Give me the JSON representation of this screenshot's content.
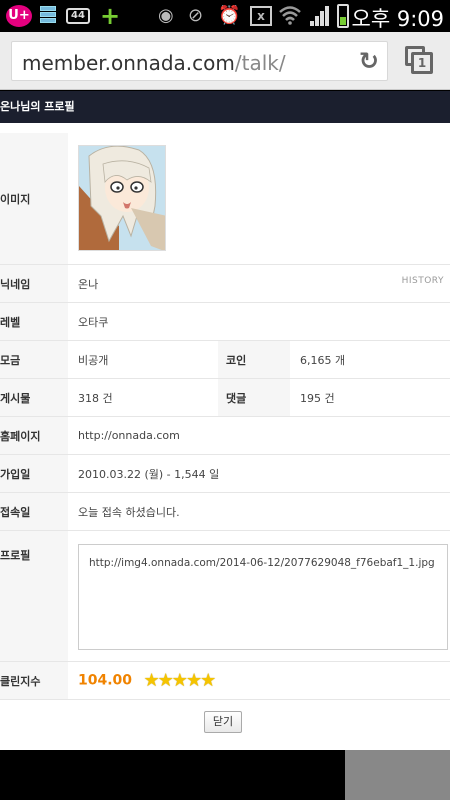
{
  "status_bar": {
    "carrier_badge": "U+",
    "notification_count": "44",
    "time": "오후 9:09"
  },
  "browser": {
    "url_host": "member.onnada.com",
    "url_path": "/talk/",
    "tab_count": "1"
  },
  "page": {
    "header_title": "온나님의 프로필",
    "rows": {
      "image_label": "이미지",
      "nickname_label": "닉네임",
      "nickname_value": "온나",
      "history_link": "HISTORY",
      "level_label": "레벨",
      "level_value": "오타쿠",
      "gender_label": "모금",
      "gender_value": "비공개",
      "coin_label": "코인",
      "coin_value": "6,165 개",
      "posts_label": "게시물",
      "posts_value": "318 건",
      "comments_label": "댓글",
      "comments_value": "195 건",
      "homepage_label": "홈페이지",
      "homepage_value": "http://onnada.com",
      "joined_label": "가입일",
      "joined_value": "2010.03.22 (월) - 1,544 일",
      "lastlogin_label": "접속일",
      "lastlogin_value": "오늘 접속 하셨습니다.",
      "profile_label": "프로필",
      "profile_value": "http://img4.onnada.com/2014-06-12/2077629048_f76ebaf1_1.jpg",
      "clean_label": "클린지수",
      "clean_value": "104.00",
      "clean_stars": 5
    },
    "close_button": "닫기"
  },
  "colors": {
    "header_bg": "#1b1f2e",
    "score": "#f08300",
    "star": "#f5c400"
  }
}
